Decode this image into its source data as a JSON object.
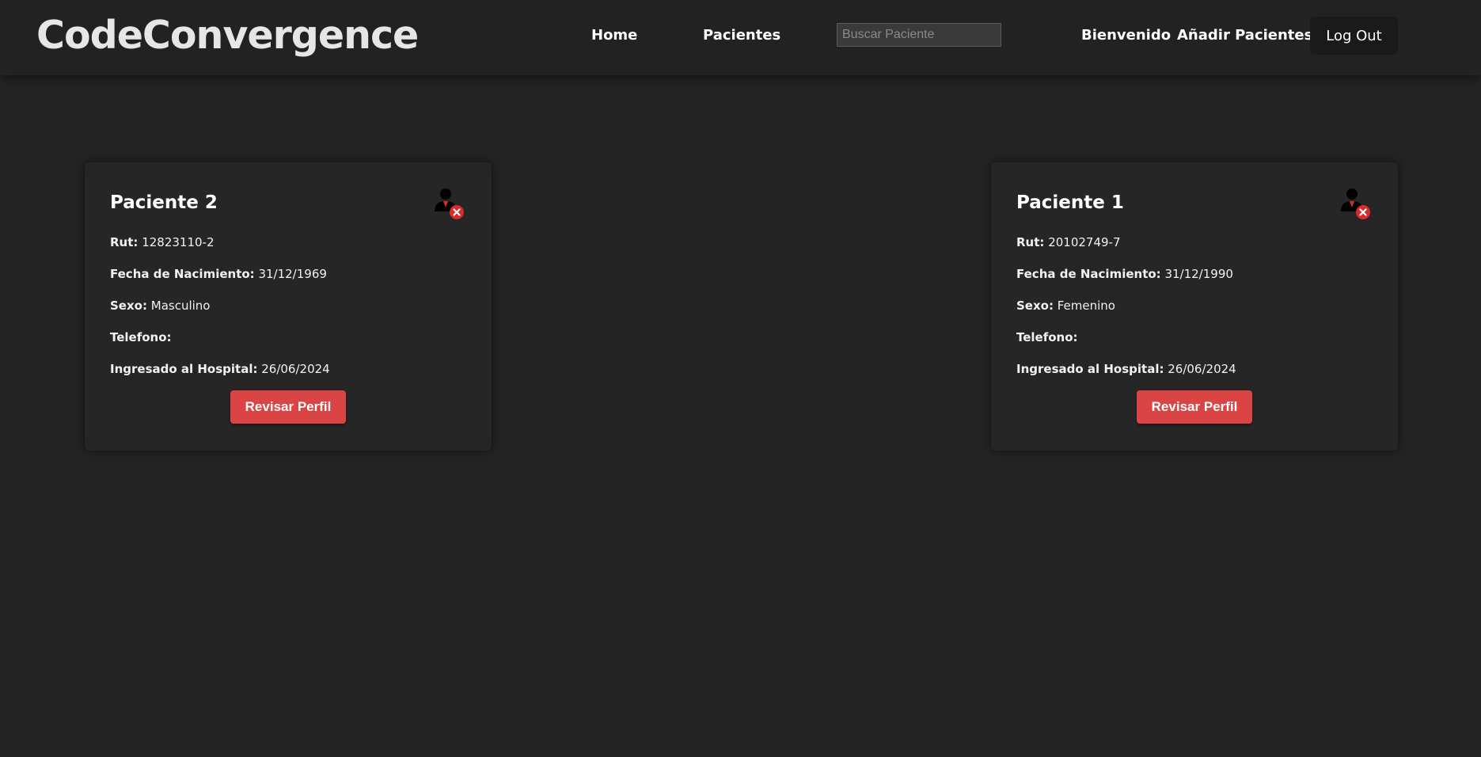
{
  "app": {
    "brand": "CodeConvergence"
  },
  "nav": {
    "home": "Home",
    "pacientes": "Pacientes",
    "search_placeholder": "Buscar Paciente",
    "search_value": "",
    "bienvenido": "Bienvenido",
    "anadir": "Añadir Pacientes",
    "logout": "Log Out"
  },
  "labels": {
    "rut": "Rut:",
    "fecha": "Fecha de Nacimiento:",
    "sexo": "Sexo:",
    "telefono": "Telefono:",
    "ingresado": "Ingresado al Hospital:"
  },
  "patients": [
    {
      "name": "Paciente 2",
      "rut": "12823110-2",
      "fecha_nacimiento": "31/12/1969",
      "sexo": "Masculino",
      "telefono": "",
      "ingresado": "26/06/2024",
      "button": "Revisar Perfil",
      "icon": "remove-patient-icon"
    },
    {
      "name": "Paciente 1",
      "rut": "20102749-7",
      "fecha_nacimiento": "31/12/1990",
      "sexo": "Femenino",
      "telefono": "",
      "ingresado": "26/06/2024",
      "button": "Revisar Perfil",
      "icon": "remove-patient-icon"
    }
  ],
  "colors": {
    "background": "#242424",
    "navbar": "#222222",
    "accent_button": "#db4444",
    "remove_badge": "#d92b2b"
  }
}
